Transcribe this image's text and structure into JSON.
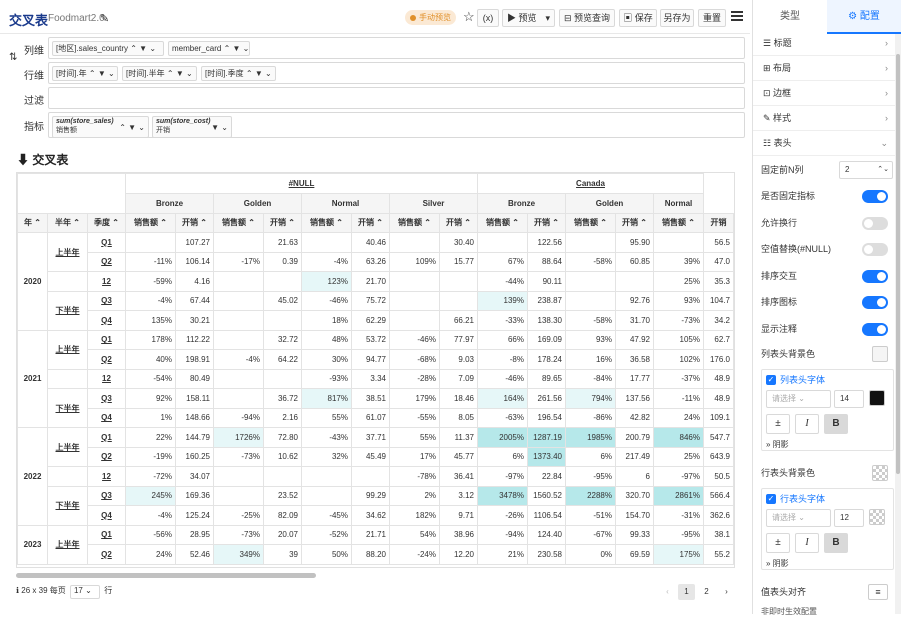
{
  "header": {
    "title": "交叉表",
    "subtitle": "Foodmart2.0",
    "preview_pill": "手动预览",
    "run_icon_label": "(x)",
    "preview_btn": "预览",
    "preview_query_btn": "预览查询",
    "save_btn": "保存",
    "save_as_btn": "另存为",
    "reset_btn": "重置"
  },
  "filters": {
    "col_label": "列维",
    "row_label": "行维",
    "filter_label": "过滤",
    "metric_label": "指标",
    "col_chips": [
      "[地区].sales_country",
      "member_card"
    ],
    "row_chips": [
      "[时间].年",
      "[时间].半年",
      "[时间].季度"
    ],
    "metric_chips": [
      {
        "top": "sum(store_sales)",
        "bottom": "销售额"
      },
      {
        "top": "sum(store_cost)",
        "bottom": "开销"
      }
    ]
  },
  "section_title": "交叉表",
  "table": {
    "level1": [
      {
        "label": "#NULL",
        "span": 8
      },
      {
        "label": "Canada",
        "span": 5
      }
    ],
    "level2": [
      {
        "label": "Bronze",
        "span": 2
      },
      {
        "label": "Golden",
        "span": 2
      },
      {
        "label": "Normal",
        "span": 2
      },
      {
        "label": "Silver",
        "span": 2
      },
      {
        "label": "Bronze",
        "span": 2
      },
      {
        "label": "Golden",
        "span": 2
      },
      {
        "label": "Normal",
        "span": 1
      }
    ],
    "dim_headers": [
      "年 ⌃",
      "半年 ⌃",
      "季度 ⌃"
    ],
    "measure_headers": [
      "销售额 ⌃",
      "开销 ⌃",
      "销售额 ⌃",
      "开销 ⌃",
      "销售额 ⌃",
      "开销 ⌃",
      "销售额 ⌃",
      "开销 ⌃",
      "销售额 ⌃",
      "开销 ⌃",
      "销售额 ⌃",
      "开销 ⌃",
      "销售额 ⌃",
      "开销"
    ],
    "rows": [
      {
        "year": "2020",
        "yspan": 5,
        "half": "上半年",
        "hspan": 2,
        "q": "Q1",
        "v": [
          "",
          "107.27",
          "",
          "21.63",
          "",
          "40.46",
          "",
          "30.40",
          "",
          "122.56",
          "",
          "95.90",
          "",
          "56.5"
        ]
      },
      {
        "q": "Q2",
        "v": [
          "-11%",
          "106.14",
          "-17%",
          "0.39",
          "-4%",
          "63.26",
          "109%",
          "15.77",
          "67%",
          "88.64",
          "-58%",
          "60.85",
          "39%",
          "47.0"
        ]
      },
      {
        "half": "",
        "hspan": 1,
        "q": "12",
        "v": [
          "-59%",
          "4.16",
          "",
          "",
          "123%",
          "21.70",
          "",
          "",
          "-44%",
          "90.11",
          "",
          "",
          "25%",
          "35.3"
        ]
      },
      {
        "half": "下半年",
        "hspan": 2,
        "q": "Q3",
        "v": [
          "-4%",
          "67.44",
          "",
          "45.02",
          "-46%",
          "75.72",
          "",
          "",
          "139%",
          "238.87",
          "",
          "92.76",
          "93%",
          "104.7"
        ]
      },
      {
        "q": "Q4",
        "v": [
          "135%",
          "30.21",
          "",
          "",
          "18%",
          "62.29",
          "",
          "66.21",
          "-33%",
          "138.30",
          "-58%",
          "31.70",
          "-73%",
          "34.2"
        ]
      },
      {
        "year": "2021",
        "yspan": 5,
        "half": "上半年",
        "hspan": 2,
        "q": "Q1",
        "v": [
          "178%",
          "112.22",
          "",
          "32.72",
          "48%",
          "53.72",
          "-46%",
          "77.97",
          "66%",
          "169.09",
          "93%",
          "47.92",
          "105%",
          "62.7"
        ]
      },
      {
        "q": "Q2",
        "v": [
          "40%",
          "198.91",
          "-4%",
          "64.22",
          "30%",
          "94.77",
          "-68%",
          "9.03",
          "-8%",
          "178.24",
          "16%",
          "36.58",
          "102%",
          "176.0"
        ]
      },
      {
        "half": "",
        "hspan": 1,
        "q": "12",
        "v": [
          "-54%",
          "80.49",
          "",
          "",
          "-93%",
          "3.34",
          "-28%",
          "7.09",
          "-46%",
          "89.65",
          "-84%",
          "17.77",
          "-37%",
          "48.9"
        ]
      },
      {
        "half": "下半年",
        "hspan": 2,
        "q": "Q3",
        "v": [
          "92%",
          "158.11",
          "",
          "36.72",
          "817%",
          "38.51",
          "179%",
          "18.46",
          "164%",
          "261.56",
          "794%",
          "137.56",
          "-11%",
          "48.9"
        ]
      },
      {
        "q": "Q4",
        "v": [
          "1%",
          "148.66",
          "-94%",
          "2.16",
          "55%",
          "61.07",
          "-55%",
          "8.05",
          "-63%",
          "196.54",
          "-86%",
          "42.82",
          "24%",
          "109.1"
        ]
      },
      {
        "year": "2022",
        "yspan": 5,
        "half": "上半年",
        "hspan": 2,
        "q": "Q1",
        "v": [
          "22%",
          "144.79",
          "1726%",
          "72.80",
          "-43%",
          "37.71",
          "55%",
          "11.37",
          "2005%",
          "1287.19",
          "1985%",
          "200.79",
          "846%",
          "547.7"
        ]
      },
      {
        "q": "Q2",
        "v": [
          "-19%",
          "160.25",
          "-73%",
          "10.62",
          "32%",
          "45.49",
          "17%",
          "45.77",
          "6%",
          "1373.40",
          "6%",
          "217.49",
          "25%",
          "643.9"
        ]
      },
      {
        "half": "",
        "hspan": 1,
        "q": "12",
        "v": [
          "-72%",
          "34.07",
          "",
          "",
          "",
          "",
          "-78%",
          "36.41",
          "-97%",
          "22.84",
          "-95%",
          "6",
          "-97%",
          "50.5"
        ]
      },
      {
        "half": "下半年",
        "hspan": 2,
        "q": "Q3",
        "v": [
          "245%",
          "169.36",
          "",
          "23.52",
          "",
          "99.29",
          "2%",
          "3.12",
          "3478%",
          "1560.52",
          "2288%",
          "320.70",
          "2861%",
          "566.4"
        ]
      },
      {
        "q": "Q4",
        "v": [
          "-4%",
          "125.24",
          "-25%",
          "82.09",
          "-45%",
          "34.62",
          "182%",
          "9.71",
          "-26%",
          "1106.54",
          "-51%",
          "154.70",
          "-31%",
          "362.6"
        ]
      },
      {
        "year": "2023",
        "yspan": 2,
        "half": "上半年",
        "hspan": 2,
        "q": "Q1",
        "v": [
          "-56%",
          "28.95",
          "-73%",
          "20.07",
          "-52%",
          "21.71",
          "54%",
          "38.96",
          "-94%",
          "124.40",
          "-67%",
          "99.33",
          "-95%",
          "38.1"
        ]
      },
      {
        "q": "Q2",
        "v": [
          "24%",
          "52.46",
          "349%",
          "39",
          "50%",
          "88.20",
          "-24%",
          "12.20",
          "21%",
          "230.58",
          "0%",
          "69.59",
          "175%",
          "55.2"
        ]
      }
    ]
  },
  "footer": {
    "summary": "26 x 39 每页",
    "page_size": "17",
    "rows_unit": "行",
    "pages": [
      "1",
      "2"
    ]
  },
  "panel": {
    "tabs": [
      "类型",
      "配置"
    ],
    "sections": [
      "标题",
      "布局",
      "边框",
      "样式",
      "表头"
    ],
    "fixed_n_label": "固定前N列",
    "fixed_n_value": "2",
    "toggles": [
      {
        "label": "是否固定指标",
        "on": true
      },
      {
        "label": "允许换行",
        "on": false
      },
      {
        "label": "空值替换(#NULL)",
        "on": false
      },
      {
        "label": "排序交互",
        "on": true
      },
      {
        "label": "排序图标",
        "on": true
      },
      {
        "label": "显示注释",
        "on": true
      }
    ],
    "col_bg_label": "列表头背景色",
    "col_font_label": "列表头字体",
    "col_font_placeholder": "请选择",
    "col_font_size": "14",
    "shadow_label": "阴影",
    "row_bg_label": "行表头背景色",
    "row_font_label": "行表头字体",
    "row_font_placeholder": "请选择",
    "row_font_size": "12",
    "align_label": "值表头对齐",
    "cut_text": "非即时生效配置"
  }
}
